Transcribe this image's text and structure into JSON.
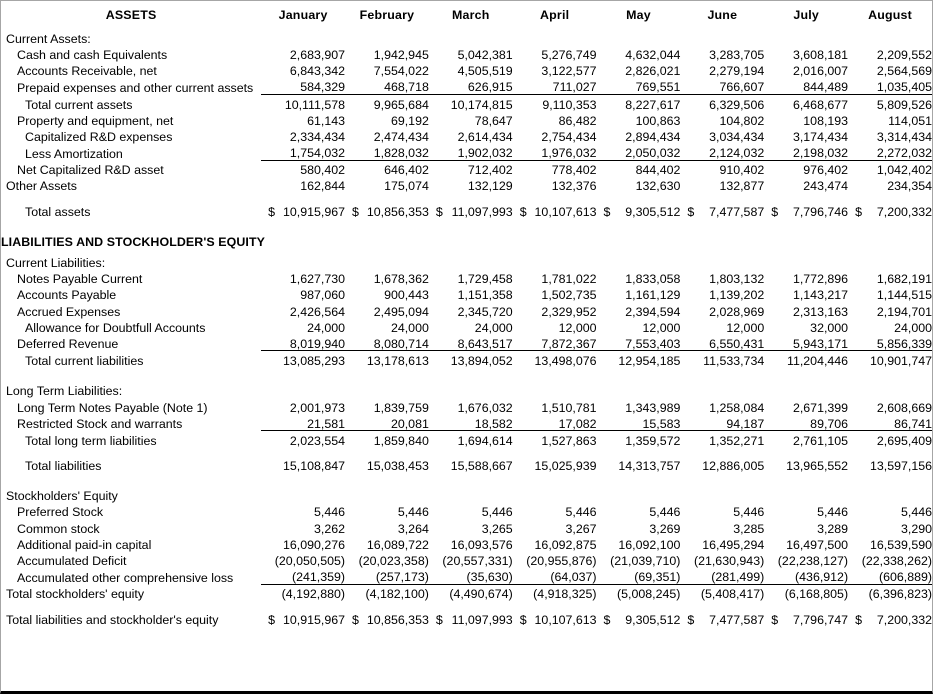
{
  "header": {
    "title_label": "ASSETS",
    "months": [
      "January",
      "February",
      "March",
      "April",
      "May",
      "June",
      "July",
      "August"
    ]
  },
  "section_header": {
    "liabilities_title": "LIABILITIES AND STOCKHOLDER'S EQUITY"
  },
  "labels": {
    "current_assets": "Current Assets:",
    "cash": "Cash and cash Equivalents",
    "accounts_receivable": "Accounts Receivable, net",
    "prepaid": "Prepaid expenses and other current assets",
    "total_current_assets": "Total current assets",
    "property": "Property and equipment, net",
    "cap_rd": "Capitalized R&D expenses",
    "less_amort": "Less Amortization",
    "net_cap_rd": "Net Capitalized R&D asset",
    "other_assets": "Other Assets",
    "total_assets": "Total assets",
    "current_liabilities": "Current Liabilities:",
    "notes_payable_current": "Notes Payable Current",
    "accounts_payable": "Accounts Payable",
    "accrued_expenses": "Accrued Expenses",
    "allowance": "Allowance for Doubtfull Accounts",
    "deferred_revenue": "Deferred Revenue",
    "total_current_liabilities": "Total current liabilities",
    "long_term_liabilities": "Long Term Liabilities:",
    "lt_notes_payable": "Long Term Notes Payable  (Note 1)",
    "restricted_stock": "Restricted Stock and warrants",
    "total_lt_liabilities": "Total long term liabilities",
    "total_liabilities": "Total liabilities",
    "stockholders_equity": "Stockholders' Equity",
    "preferred_stock": "Preferred Stock",
    "common_stock": "Common stock",
    "apic": "Additional paid-in capital",
    "accumulated_deficit": "Accumulated Deficit",
    "aoci": "Accumulated other comprehensive loss",
    "total_stockholders_equity": "Total stockholders' equity",
    "total_liab_equity": "Total liabilities and stockholder's equity"
  },
  "chart_data": {
    "type": "table",
    "title": "Balance Sheet by Month",
    "categories": [
      "January",
      "February",
      "March",
      "April",
      "May",
      "June",
      "July",
      "August"
    ],
    "series": [
      {
        "name": "Cash and cash Equivalents",
        "values": [
          "2,683,907",
          "1,942,945",
          "5,042,381",
          "5,276,749",
          "4,632,044",
          "3,283,705",
          "3,608,181",
          "2,209,552"
        ]
      },
      {
        "name": "Accounts Receivable, net",
        "values": [
          "6,843,342",
          "7,554,022",
          "4,505,519",
          "3,122,577",
          "2,826,021",
          "2,279,194",
          "2,016,007",
          "2,564,569"
        ]
      },
      {
        "name": "Prepaid expenses and other current assets",
        "values": [
          "584,329",
          "468,718",
          "626,915",
          "711,027",
          "769,551",
          "766,607",
          "844,489",
          "1,035,405"
        ]
      },
      {
        "name": "Total current assets",
        "values": [
          "10,111,578",
          "9,965,684",
          "10,174,815",
          "9,110,353",
          "8,227,617",
          "6,329,506",
          "6,468,677",
          "5,809,526"
        ]
      },
      {
        "name": "Property and equipment, net",
        "values": [
          "61,143",
          "69,192",
          "78,647",
          "86,482",
          "100,863",
          "104,802",
          "108,193",
          "114,051"
        ]
      },
      {
        "name": "Capitalized R&D expenses",
        "values": [
          "2,334,434",
          "2,474,434",
          "2,614,434",
          "2,754,434",
          "2,894,434",
          "3,034,434",
          "3,174,434",
          "3,314,434"
        ]
      },
      {
        "name": "Less Amortization",
        "values": [
          "1,754,032",
          "1,828,032",
          "1,902,032",
          "1,976,032",
          "2,050,032",
          "2,124,032",
          "2,198,032",
          "2,272,032"
        ]
      },
      {
        "name": "Net Capitalized R&D asset",
        "values": [
          "580,402",
          "646,402",
          "712,402",
          "778,402",
          "844,402",
          "910,402",
          "976,402",
          "1,042,402"
        ]
      },
      {
        "name": "Other Assets",
        "values": [
          "162,844",
          "175,074",
          "132,129",
          "132,376",
          "132,630",
          "132,877",
          "243,474",
          "234,354"
        ]
      },
      {
        "name": "Total assets",
        "values": [
          "10,915,967",
          "10,856,353",
          "11,097,993",
          "10,107,613",
          "9,305,512",
          "7,477,587",
          "7,796,746",
          "7,200,332"
        ]
      },
      {
        "name": "Notes Payable Current",
        "values": [
          "1,627,730",
          "1,678,362",
          "1,729,458",
          "1,781,022",
          "1,833,058",
          "1,803,132",
          "1,772,896",
          "1,682,191"
        ]
      },
      {
        "name": "Accounts Payable",
        "values": [
          "987,060",
          "900,443",
          "1,151,358",
          "1,502,735",
          "1,161,129",
          "1,139,202",
          "1,143,217",
          "1,144,515"
        ]
      },
      {
        "name": "Accrued Expenses",
        "values": [
          "2,426,564",
          "2,495,094",
          "2,345,720",
          "2,329,952",
          "2,394,594",
          "2,028,969",
          "2,313,163",
          "2,194,701"
        ]
      },
      {
        "name": "Allowance for Doubtfull Accounts",
        "values": [
          "24,000",
          "24,000",
          "24,000",
          "12,000",
          "12,000",
          "12,000",
          "32,000",
          "24,000"
        ]
      },
      {
        "name": "Deferred Revenue",
        "values": [
          "8,019,940",
          "8,080,714",
          "8,643,517",
          "7,872,367",
          "7,553,403",
          "6,550,431",
          "5,943,171",
          "5,856,339"
        ]
      },
      {
        "name": "Total current liabilities",
        "values": [
          "13,085,293",
          "13,178,613",
          "13,894,052",
          "13,498,076",
          "12,954,185",
          "11,533,734",
          "11,204,446",
          "10,901,747"
        ]
      },
      {
        "name": "Long Term Notes Payable  (Note 1)",
        "values": [
          "2,001,973",
          "1,839,759",
          "1,676,032",
          "1,510,781",
          "1,343,989",
          "1,258,084",
          "2,671,399",
          "2,608,669"
        ]
      },
      {
        "name": "Restricted Stock and warrants",
        "values": [
          "21,581",
          "20,081",
          "18,582",
          "17,082",
          "15,583",
          "94,187",
          "89,706",
          "86,741"
        ]
      },
      {
        "name": "Total long term liabilities",
        "values": [
          "2,023,554",
          "1,859,840",
          "1,694,614",
          "1,527,863",
          "1,359,572",
          "1,352,271",
          "2,761,105",
          "2,695,409"
        ]
      },
      {
        "name": "Total liabilities",
        "values": [
          "15,108,847",
          "15,038,453",
          "15,588,667",
          "15,025,939",
          "14,313,757",
          "12,886,005",
          "13,965,552",
          "13,597,156"
        ]
      },
      {
        "name": "Preferred Stock",
        "values": [
          "5,446",
          "5,446",
          "5,446",
          "5,446",
          "5,446",
          "5,446",
          "5,446",
          "5,446"
        ]
      },
      {
        "name": "Common stock",
        "values": [
          "3,262",
          "3,264",
          "3,265",
          "3,267",
          "3,269",
          "3,285",
          "3,289",
          "3,290"
        ]
      },
      {
        "name": "Additional paid-in capital",
        "values": [
          "16,090,276",
          "16,089,722",
          "16,093,576",
          "16,092,875",
          "16,092,100",
          "16,495,294",
          "16,497,500",
          "16,539,590"
        ]
      },
      {
        "name": "Accumulated Deficit",
        "values": [
          "(20,050,505)",
          "(20,023,358)",
          "(20,557,331)",
          "(20,955,876)",
          "(21,039,710)",
          "(21,630,943)",
          "(22,238,127)",
          "(22,338,262)"
        ]
      },
      {
        "name": "Accumulated other comprehensive loss",
        "values": [
          "(241,359)",
          "(257,173)",
          "(35,630)",
          "(64,037)",
          "(69,351)",
          "(281,499)",
          "(436,912)",
          "(606,889)"
        ]
      },
      {
        "name": "Total stockholders' equity",
        "values": [
          "(4,192,880)",
          "(4,182,100)",
          "(4,490,674)",
          "(4,918,325)",
          "(5,008,245)",
          "(5,408,417)",
          "(6,168,805)",
          "(6,396,823)"
        ]
      },
      {
        "name": "Total liabilities and stockholder's equity",
        "values": [
          "10,915,967",
          "10,856,353",
          "11,097,993",
          "10,107,613",
          "9,305,512",
          "7,477,587",
          "7,796,747",
          "7,200,332"
        ]
      }
    ],
    "currency_symbol": "$",
    "currency_rows": [
      "Total assets",
      "Total liabilities and stockholder's equity"
    ]
  },
  "rows": {
    "cash": [
      "2,683,907",
      "1,942,945",
      "5,042,381",
      "5,276,749",
      "4,632,044",
      "3,283,705",
      "3,608,181",
      "2,209,552"
    ],
    "accounts_receivable": [
      "6,843,342",
      "7,554,022",
      "4,505,519",
      "3,122,577",
      "2,826,021",
      "2,279,194",
      "2,016,007",
      "2,564,569"
    ],
    "prepaid": [
      "584,329",
      "468,718",
      "626,915",
      "711,027",
      "769,551",
      "766,607",
      "844,489",
      "1,035,405"
    ],
    "total_current_assets": [
      "10,111,578",
      "9,965,684",
      "10,174,815",
      "9,110,353",
      "8,227,617",
      "6,329,506",
      "6,468,677",
      "5,809,526"
    ],
    "property": [
      "61,143",
      "69,192",
      "78,647",
      "86,482",
      "100,863",
      "104,802",
      "108,193",
      "114,051"
    ],
    "cap_rd": [
      "2,334,434",
      "2,474,434",
      "2,614,434",
      "2,754,434",
      "2,894,434",
      "3,034,434",
      "3,174,434",
      "3,314,434"
    ],
    "less_amort": [
      "1,754,032",
      "1,828,032",
      "1,902,032",
      "1,976,032",
      "2,050,032",
      "2,124,032",
      "2,198,032",
      "2,272,032"
    ],
    "net_cap_rd": [
      "580,402",
      "646,402",
      "712,402",
      "778,402",
      "844,402",
      "910,402",
      "976,402",
      "1,042,402"
    ],
    "other_assets": [
      "162,844",
      "175,074",
      "132,129",
      "132,376",
      "132,630",
      "132,877",
      "243,474",
      "234,354"
    ],
    "total_assets": [
      "10,915,967",
      "10,856,353",
      "11,097,993",
      "10,107,613",
      "9,305,512",
      "7,477,587",
      "7,796,746",
      "7,200,332"
    ],
    "notes_payable_current": [
      "1,627,730",
      "1,678,362",
      "1,729,458",
      "1,781,022",
      "1,833,058",
      "1,803,132",
      "1,772,896",
      "1,682,191"
    ],
    "accounts_payable": [
      "987,060",
      "900,443",
      "1,151,358",
      "1,502,735",
      "1,161,129",
      "1,139,202",
      "1,143,217",
      "1,144,515"
    ],
    "accrued_expenses": [
      "2,426,564",
      "2,495,094",
      "2,345,720",
      "2,329,952",
      "2,394,594",
      "2,028,969",
      "2,313,163",
      "2,194,701"
    ],
    "allowance": [
      "24,000",
      "24,000",
      "24,000",
      "12,000",
      "12,000",
      "12,000",
      "32,000",
      "24,000"
    ],
    "deferred_revenue": [
      "8,019,940",
      "8,080,714",
      "8,643,517",
      "7,872,367",
      "7,553,403",
      "6,550,431",
      "5,943,171",
      "5,856,339"
    ],
    "total_current_liabilities": [
      "13,085,293",
      "13,178,613",
      "13,894,052",
      "13,498,076",
      "12,954,185",
      "11,533,734",
      "11,204,446",
      "10,901,747"
    ],
    "lt_notes_payable": [
      "2,001,973",
      "1,839,759",
      "1,676,032",
      "1,510,781",
      "1,343,989",
      "1,258,084",
      "2,671,399",
      "2,608,669"
    ],
    "restricted_stock": [
      "21,581",
      "20,081",
      "18,582",
      "17,082",
      "15,583",
      "94,187",
      "89,706",
      "86,741"
    ],
    "total_lt_liabilities": [
      "2,023,554",
      "1,859,840",
      "1,694,614",
      "1,527,863",
      "1,359,572",
      "1,352,271",
      "2,761,105",
      "2,695,409"
    ],
    "total_liabilities": [
      "15,108,847",
      "15,038,453",
      "15,588,667",
      "15,025,939",
      "14,313,757",
      "12,886,005",
      "13,965,552",
      "13,597,156"
    ],
    "preferred_stock": [
      "5,446",
      "5,446",
      "5,446",
      "5,446",
      "5,446",
      "5,446",
      "5,446",
      "5,446"
    ],
    "common_stock": [
      "3,262",
      "3,264",
      "3,265",
      "3,267",
      "3,269",
      "3,285",
      "3,289",
      "3,290"
    ],
    "apic": [
      "16,090,276",
      "16,089,722",
      "16,093,576",
      "16,092,875",
      "16,092,100",
      "16,495,294",
      "16,497,500",
      "16,539,590"
    ],
    "accumulated_deficit": [
      "(20,050,505)",
      "(20,023,358)",
      "(20,557,331)",
      "(20,955,876)",
      "(21,039,710)",
      "(21,630,943)",
      "(22,238,127)",
      "(22,338,262)"
    ],
    "aoci": [
      "(241,359)",
      "(257,173)",
      "(35,630)",
      "(64,037)",
      "(69,351)",
      "(281,499)",
      "(436,912)",
      "(606,889)"
    ],
    "total_stockholders_equity": [
      "(4,192,880)",
      "(4,182,100)",
      "(4,490,674)",
      "(4,918,325)",
      "(5,008,245)",
      "(5,408,417)",
      "(6,168,805)",
      "(6,396,823)"
    ],
    "total_liab_equity": [
      "10,915,967",
      "10,856,353",
      "11,097,993",
      "10,107,613",
      "9,305,512",
      "7,477,587",
      "7,796,747",
      "7,200,332"
    ]
  },
  "symbols": {
    "currency": "$"
  }
}
